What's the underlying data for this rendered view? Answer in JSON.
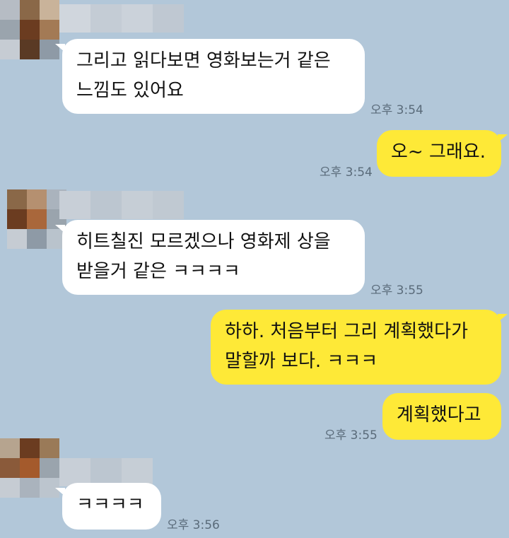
{
  "theme": {
    "background": "#b2c7d9",
    "incoming_bubble": "#ffffff",
    "outgoing_bubble": "#fee937"
  },
  "messages": [
    {
      "from": "other",
      "text": "그리고 읽다보면 영화보는거 같은\n느낌도 있어요",
      "time": "오후 3:54"
    },
    {
      "from": "me",
      "text": "오~ 그래요.",
      "time": "오후 3:54"
    },
    {
      "from": "other",
      "text": "히트칠진 모르겠으나 영화제 상을\n받을거 같은 ㅋㅋㅋㅋ",
      "time": "오후 3:55"
    },
    {
      "from": "me",
      "text": "하하. 처음부터 그리 계획했다가\n말할까 보다. ㅋㅋㅋ",
      "time": ""
    },
    {
      "from": "me",
      "text": "계획했다고",
      "time": "오후 3:55"
    },
    {
      "from": "other",
      "text": "ㅋㅋㅋㅋ",
      "time": "오후 3:56"
    }
  ]
}
